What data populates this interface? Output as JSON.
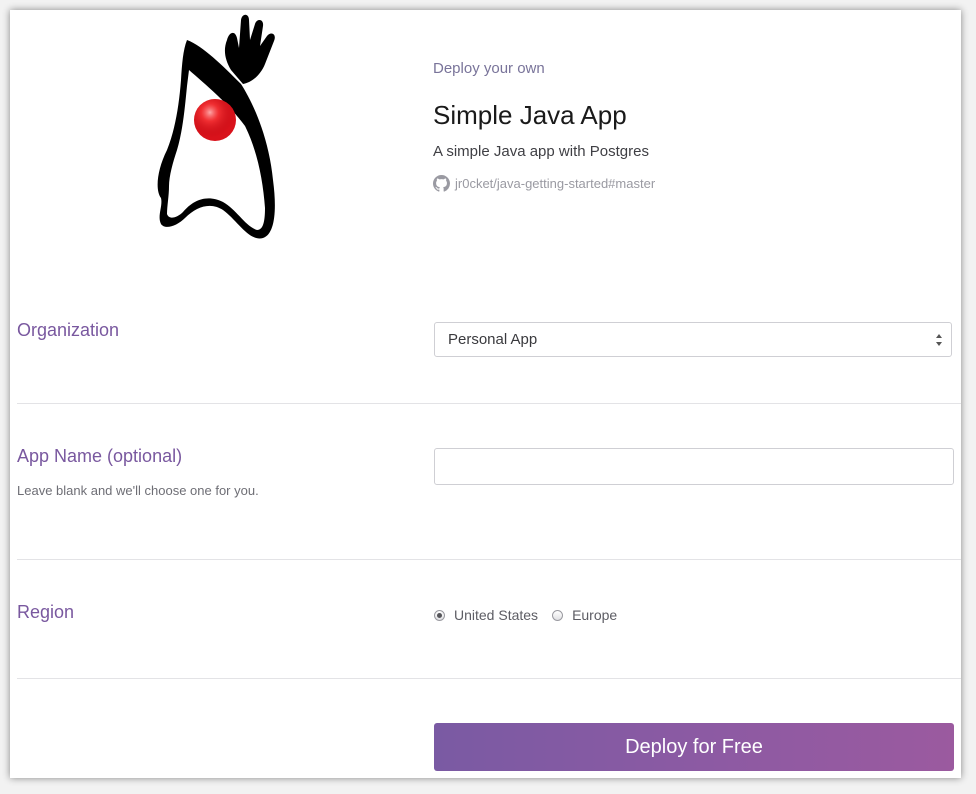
{
  "header": {
    "deploy_label": "Deploy your own",
    "app_title": "Simple Java App",
    "app_description": "A simple Java app with Postgres",
    "repo": "jr0cket/java-getting-started#master",
    "repo_icon": "github-icon",
    "mascot_icon": "java-duke-mascot"
  },
  "organization": {
    "label": "Organization",
    "selected": "Personal App"
  },
  "app_name": {
    "label": "App Name (optional)",
    "hint": "Leave blank and we'll choose one for you.",
    "value": "",
    "placeholder": ""
  },
  "region": {
    "label": "Region",
    "options": [
      {
        "label": "United States",
        "checked": true
      },
      {
        "label": "Europe",
        "checked": false
      }
    ]
  },
  "deploy_button": {
    "label": "Deploy for Free"
  },
  "colors": {
    "label_purple": "#79589f",
    "button_gradient_start": "#7a5aa3",
    "button_gradient_end": "#9b5a9f"
  }
}
